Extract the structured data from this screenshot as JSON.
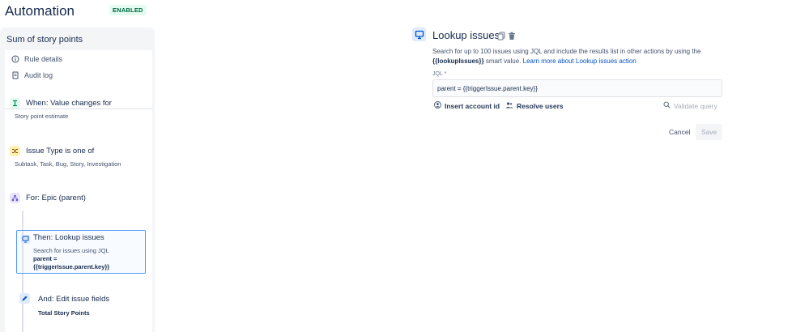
{
  "header": {
    "title": "Automation",
    "status_badge": "ENABLED"
  },
  "sidebar": {
    "rule_name": "Sum of story points",
    "links": [
      {
        "label": "Rule details",
        "icon": "info-icon"
      },
      {
        "label": "Audit log",
        "icon": "document-icon"
      }
    ],
    "flow": [
      {
        "title": "When: Value changes for",
        "description": "Story point estimate",
        "icon": "trigger-icon",
        "color": "#00875a"
      },
      {
        "title": "Issue Type is one of",
        "description": "Subtask, Task, Bug, Story, Investigation",
        "icon": "shuffle-icon",
        "color": "#ff991f"
      },
      {
        "title": "For: Epic (parent)",
        "icon": "hierarchy-icon",
        "color": "#6554c0"
      }
    ],
    "selected_node": {
      "title": "Then: Lookup issues",
      "description": "Search for issues using JQL",
      "bold_line_1": "parent =",
      "bold_line_2": "{{triggerIssue.parent.key}}"
    },
    "edit_node": {
      "title": "And: Edit issue fields",
      "bold_value": "Total Story Points"
    }
  },
  "config": {
    "title": "Lookup issues",
    "description_part1": "Search for up to 100 issues using JQL and include the results list in other actions by using the",
    "smart_value": "{{lookupIssues}}",
    "description_part2": "smart value.",
    "learn_more": "Learn more about Lookup issues action",
    "jql_label": "JQL *",
    "jql_value": "parent = {{triggerIssue.parent.key}}",
    "actions": {
      "insert_account_id": "Insert account id",
      "resolve_users": "Resolve users",
      "validate_query": "Validate query"
    },
    "buttons": {
      "cancel": "Cancel",
      "save": "Save"
    }
  },
  "colors": {
    "accent": "#0052cc",
    "selection_border": "#4c9aff",
    "enabled_green": "#006644"
  }
}
